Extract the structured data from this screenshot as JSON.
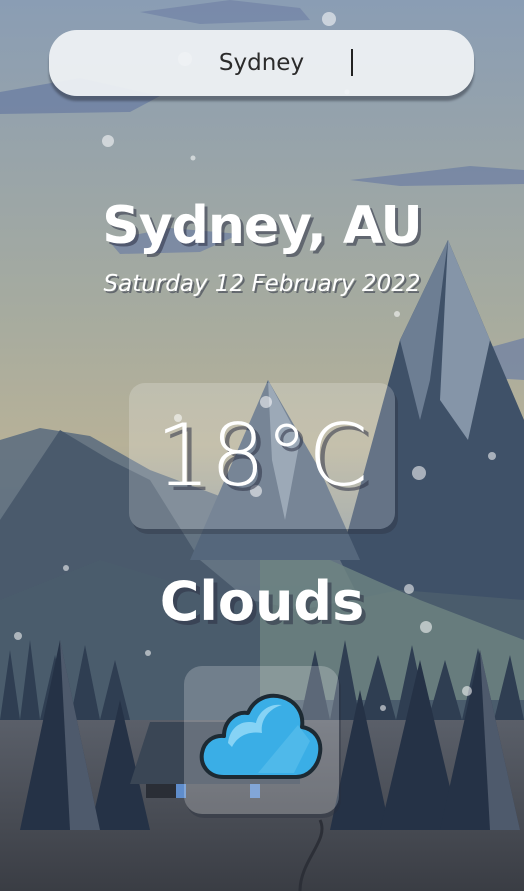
{
  "search": {
    "value": "Sydney"
  },
  "location": {
    "label": "Sydney, AU"
  },
  "date": {
    "label": "Saturday 12 February 2022"
  },
  "weather": {
    "temperature": "18°C",
    "condition": "Clouds",
    "icon": "cloud-icon"
  },
  "colors": {
    "sky_top": "#8a9fb5",
    "sky_mid": "#a9ab9c",
    "mountain": "#3d4f66",
    "ground": "#3a3f4c",
    "cloud_icon": "#3aaee6"
  }
}
